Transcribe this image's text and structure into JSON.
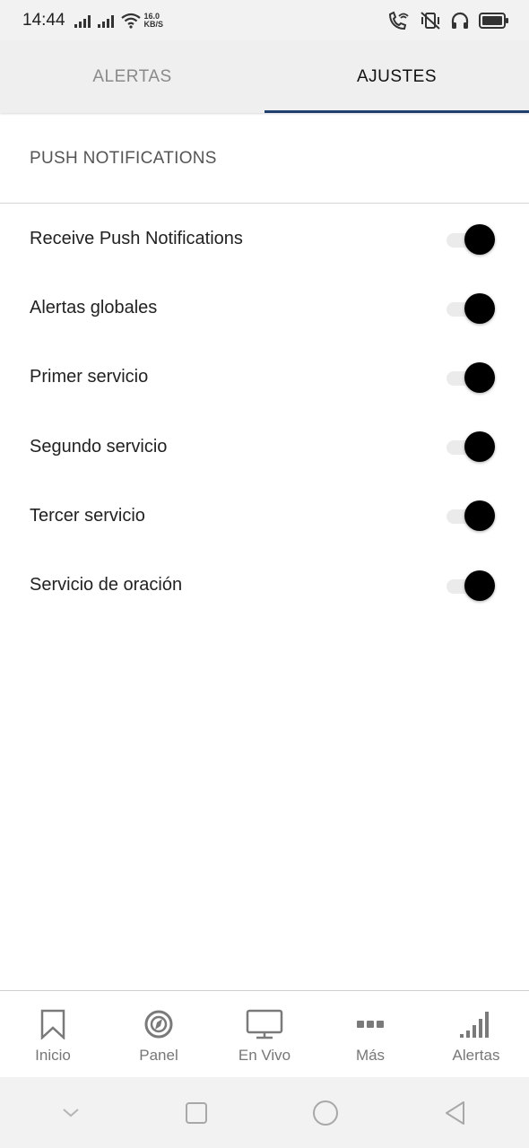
{
  "status_bar": {
    "time": "14:44",
    "speed_value": "16.0",
    "speed_unit": "KB/S",
    "icons": [
      "signal-icon",
      "signal-icon",
      "wifi-icon",
      "wifi-calling-icon",
      "vibrate-off-icon",
      "headphones-icon",
      "battery-icon"
    ]
  },
  "tabs": [
    {
      "label": "ALERTAS",
      "active": false
    },
    {
      "label": "AJUSTES",
      "active": true
    }
  ],
  "section": {
    "title": "PUSH NOTIFICATIONS"
  },
  "settings": [
    {
      "label": "Receive Push Notifications",
      "enabled": true
    },
    {
      "label": "Alertas globales",
      "enabled": true
    },
    {
      "label": "Primer servicio",
      "enabled": true
    },
    {
      "label": "Segundo servicio",
      "enabled": true
    },
    {
      "label": "Tercer servicio",
      "enabled": true
    },
    {
      "label": "Servicio de oración",
      "enabled": true
    }
  ],
  "bottom_nav": [
    {
      "label": "Inicio",
      "icon": "bookmark-icon"
    },
    {
      "label": "Panel",
      "icon": "compass-icon"
    },
    {
      "label": "En Vivo",
      "icon": "monitor-icon"
    },
    {
      "label": "Más",
      "icon": "more-icon"
    },
    {
      "label": "Alertas",
      "icon": "signal-bars-icon"
    }
  ],
  "colors": {
    "tab_indicator": "#1f3f6e",
    "toggle_thumb": "#000000",
    "toggle_track": "#ebebeb",
    "nav_icon": "#7a7a7a"
  }
}
